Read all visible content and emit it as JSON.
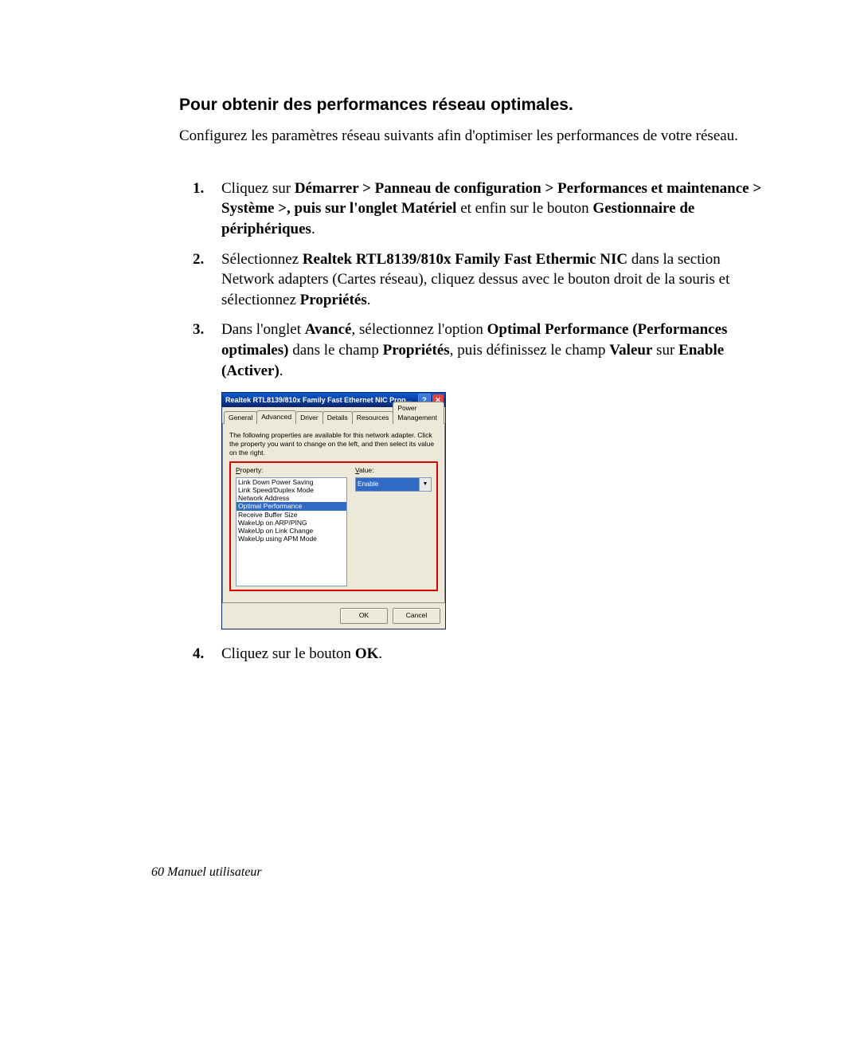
{
  "heading": "Pour obtenir des performances réseau optimales.",
  "intro": "Configurez les paramètres réseau suivants afin d'optimiser les performances de votre réseau.",
  "steps": {
    "s1": {
      "t1": "Cliquez sur ",
      "b1": "Démarrer > Panneau de configuration > Performances et maintenance > Système >, puis sur l'onglet Matériel",
      "t2": " et enfin sur le bouton ",
      "b2": "Gestionnaire de périphériques",
      "t3": "."
    },
    "s2": {
      "t1": "Sélectionnez ",
      "b1": "Realtek RTL8139/810x Family Fast Ethermic NIC",
      "t2": " dans la section Network adapters (Cartes réseau), cliquez dessus avec le bouton droit de la souris et sélectionnez ",
      "b2": "Propriétés",
      "t3": "."
    },
    "s3": {
      "t1": "Dans l'onglet ",
      "b1": "Avancé",
      "t2": ", sélectionnez l'option ",
      "b2": "Optimal Performance (Performances optimales)",
      "t3": " dans le champ ",
      "b3": "Propriétés",
      "t4": ", puis définissez le champ ",
      "b4": "Valeur",
      "t5": " sur ",
      "b5": "Enable (Activer)",
      "t6": "."
    },
    "s4": {
      "t1": "Cliquez sur le bouton ",
      "b1": "OK",
      "t2": "."
    }
  },
  "dialog": {
    "title": "Realtek RTL8139/810x Family Fast Ethernet NIC Prop...",
    "help": "?",
    "close": "✕",
    "tabs": {
      "general": "General",
      "advanced": "Advanced",
      "driver": "Driver",
      "details": "Details",
      "resources": "Resources",
      "power": "Power Management"
    },
    "instruction": "The following properties are available for this network adapter. Click the property you want to change on the left, and then select its value on the right.",
    "property_label_u": "P",
    "property_label": "roperty:",
    "value_label_u": "V",
    "value_label": "alue:",
    "properties": {
      "p0": "Link Down Power Saving",
      "p1": "Link Speed/Duplex Mode",
      "p2": "Network Address",
      "p3": "Optimal Performance",
      "p4": "Receive Buffer Size",
      "p5": "WakeUp on ARP/PING",
      "p6": "WakeUp on Link Change",
      "p7": "WakeUp using APM Mode"
    },
    "value_selected": "Enable",
    "ok": "OK",
    "cancel": "Cancel"
  },
  "footer": "60  Manuel utilisateur"
}
